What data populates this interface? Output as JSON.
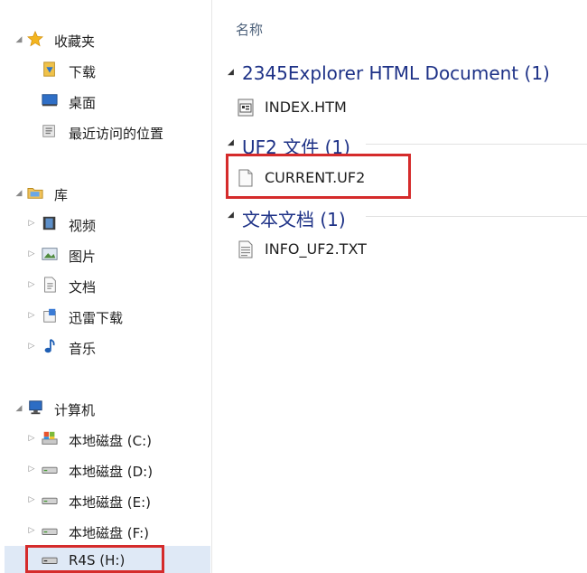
{
  "nav": {
    "favorites": {
      "label": "收藏夹",
      "items": [
        {
          "label": "下载",
          "icon": "downloads-folder-icon"
        },
        {
          "label": "桌面",
          "icon": "desktop-icon"
        },
        {
          "label": "最近访问的位置",
          "icon": "recent-places-icon"
        }
      ]
    },
    "libraries": {
      "label": "库",
      "items": [
        {
          "label": "视频",
          "icon": "videos-library-icon"
        },
        {
          "label": "图片",
          "icon": "pictures-library-icon"
        },
        {
          "label": "文档",
          "icon": "documents-library-icon"
        },
        {
          "label": "迅雷下载",
          "icon": "thunder-download-icon"
        },
        {
          "label": "音乐",
          "icon": "music-library-icon"
        }
      ]
    },
    "computer": {
      "label": "计算机",
      "items": [
        {
          "label": "本地磁盘 (C:)",
          "icon": "system-drive-icon"
        },
        {
          "label": "本地磁盘 (D:)",
          "icon": "drive-icon"
        },
        {
          "label": "本地磁盘 (E:)",
          "icon": "drive-icon"
        },
        {
          "label": "本地磁盘 (F:)",
          "icon": "drive-icon"
        },
        {
          "label": "R4S (H:)",
          "icon": "removable-drive-icon",
          "selected": true
        }
      ]
    }
  },
  "content": {
    "column_header": "名称",
    "groups": [
      {
        "name": "2345Explorer HTML Document (1)",
        "files": [
          {
            "name": "INDEX.HTM",
            "icon": "html-file-icon"
          }
        ]
      },
      {
        "name": "UF2 文件 (1)",
        "files": [
          {
            "name": "CURRENT.UF2",
            "icon": "blank-file-icon"
          }
        ]
      },
      {
        "name": "文本文档 (1)",
        "files": [
          {
            "name": "INFO_UF2.TXT",
            "icon": "text-file-icon"
          }
        ]
      }
    ]
  },
  "colors": {
    "highlight": "#d52b2b",
    "group_heading": "#1e3287",
    "selection": "#dfe9f6"
  }
}
